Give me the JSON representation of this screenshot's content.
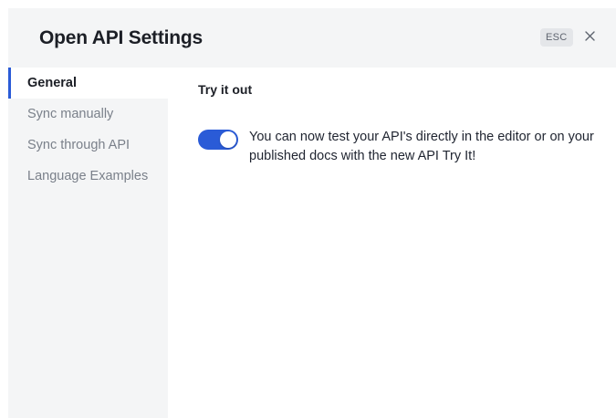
{
  "header": {
    "title": "Open API Settings",
    "esc_label": "ESC"
  },
  "sidebar": {
    "items": [
      {
        "label": "General",
        "active": true
      },
      {
        "label": "Sync manually",
        "active": false
      },
      {
        "label": "Sync through API",
        "active": false
      },
      {
        "label": "Language Examples",
        "active": false
      }
    ]
  },
  "content": {
    "section_title": "Try it out",
    "toggle_enabled": true,
    "description": "You can now test your API's directly in the editor or on your published docs with the new API Try It!"
  },
  "colors": {
    "accent": "#2a5bd7",
    "panel_bg": "#f4f5f6"
  },
  "icons": {
    "close": "close-icon"
  }
}
